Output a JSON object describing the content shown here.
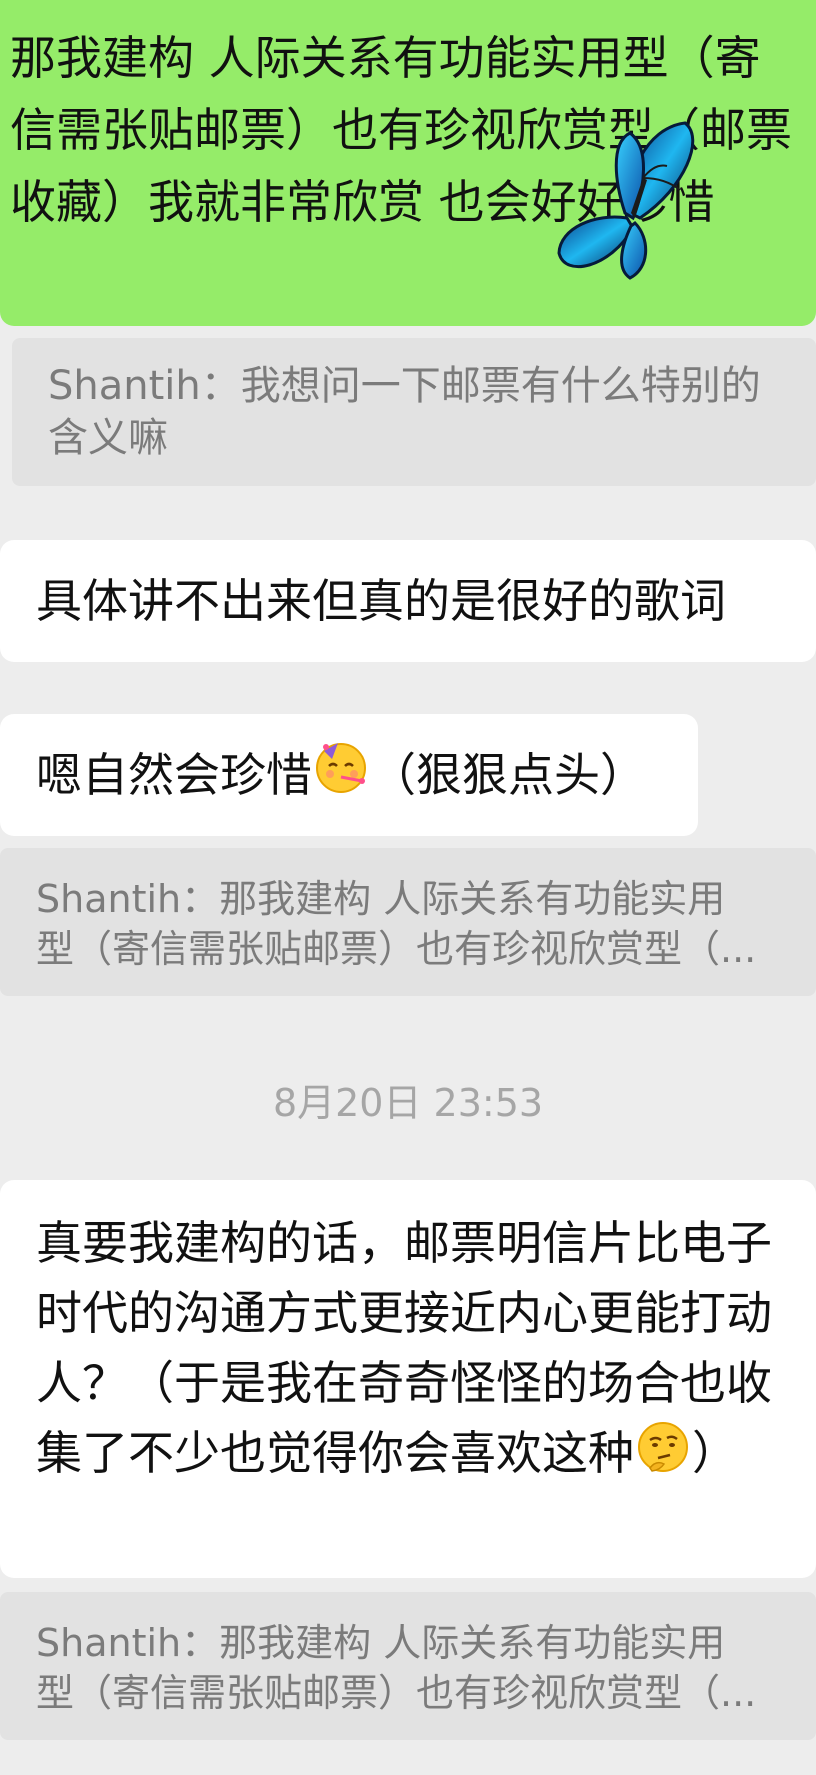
{
  "messages": {
    "m1": {
      "sender": "self",
      "text": "那我建构  人际关系有功能实用型（寄信需张贴邮票）也有珍视欣赏型（邮票收藏）我就非常欣赏  也会好好珍惜"
    },
    "q1": {
      "text": "Shantih：我想问一下邮票有什么特别的含义嘛"
    },
    "m2": {
      "text": "具体讲不出来但真的是很好的歌词"
    },
    "m3": {
      "text_before": "嗯自然会珍惜",
      "emoji": "partying-face-emoji",
      "text_after": "（狠狠点头）"
    },
    "q2": {
      "line1": "Shantih：那我建构  人际关系有功能实用",
      "line2": "型（寄信需张贴邮票）也有珍视欣赏型（..."
    },
    "timestamp": "8月20日 23:53",
    "m4": {
      "text_before": "真要我建构的话，邮票明信片比电子时代的沟通方式更接近内心更能打动人？（于是我在奇奇怪怪的场合也收集了不少也觉得你会喜欢这种",
      "emoji": "thinking-face-emoji",
      "text_after": "）"
    },
    "q3": {
      "line1": "Shantih：那我建构  人际关系有功能实用",
      "line2": "型（寄信需张贴邮票）也有珍视欣赏型（..."
    }
  },
  "colors": {
    "background": "#ededed",
    "outgoing_bubble": "#95ec69",
    "incoming_bubble": "#ffffff",
    "quote_bubble": "#e2e2e2",
    "quote_text": "#7b7b7b",
    "timestamp_text": "#a6a6a6"
  }
}
